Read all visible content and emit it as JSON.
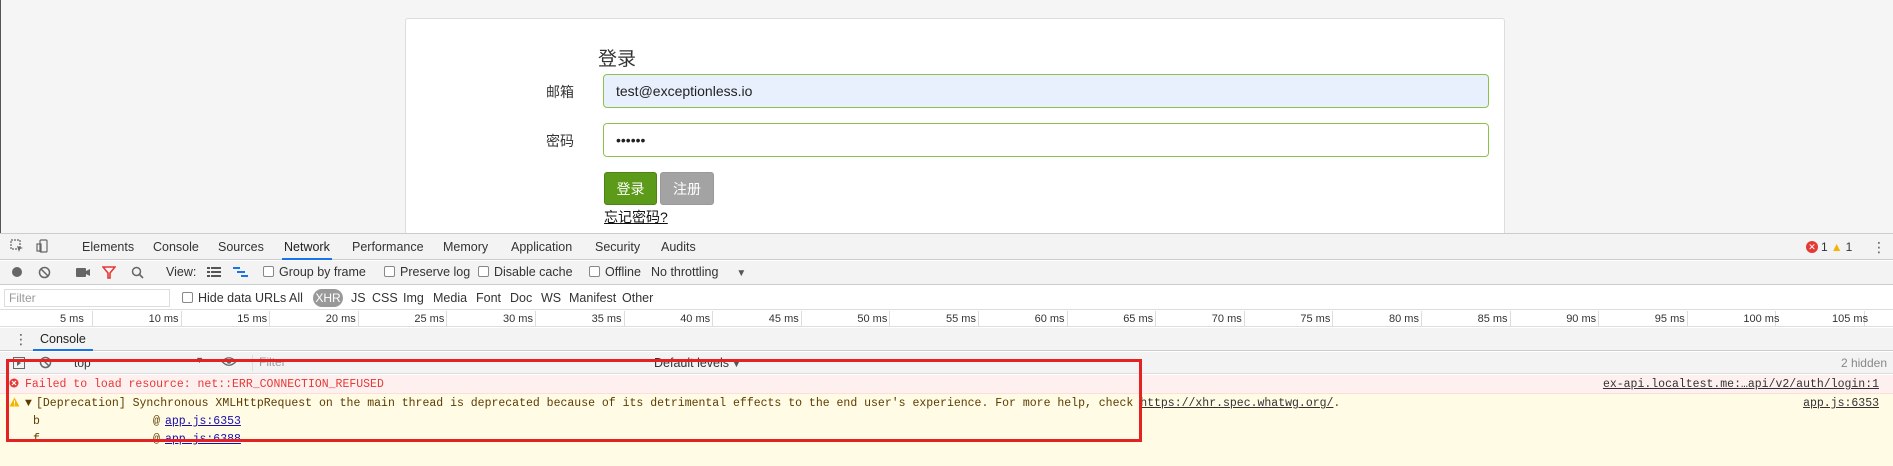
{
  "page": {
    "title": "登录",
    "email_label": "邮箱",
    "email_value": "test@exceptionless.io",
    "password_label": "密码",
    "password_value": "••••••",
    "login_button": "登录",
    "register_button": "注册",
    "forgot_link": "忘记密码?"
  },
  "devtools": {
    "tabs": [
      "Elements",
      "Console",
      "Sources",
      "Network",
      "Performance",
      "Memory",
      "Application",
      "Security",
      "Audits"
    ],
    "active_tab": "Network",
    "error_count": "1",
    "warning_count": "1",
    "toolbar": {
      "view_label": "View:",
      "group_by_frame": "Group by frame",
      "preserve_log": "Preserve log",
      "disable_cache": "Disable cache",
      "offline": "Offline",
      "throttling": "No throttling"
    },
    "filterbar": {
      "filter_placeholder": "Filter",
      "hide_data_urls": "Hide data URLs",
      "types": [
        "All",
        "XHR",
        "JS",
        "CSS",
        "Img",
        "Media",
        "Font",
        "Doc",
        "WS",
        "Manifest",
        "Other"
      ],
      "active_type": "XHR"
    },
    "timeline_ticks": [
      "5 ms",
      "10 ms",
      "15 ms",
      "20 ms",
      "25 ms",
      "30 ms",
      "35 ms",
      "40 ms",
      "45 ms",
      "50 ms",
      "55 ms",
      "60 ms",
      "65 ms",
      "70 ms",
      "75 ms",
      "80 ms",
      "85 ms",
      "90 ms",
      "95 ms",
      "100 ms",
      "105 ms"
    ],
    "drawer_tab": "Console",
    "console": {
      "context": "top",
      "filter_placeholder": "Filter",
      "levels": "Default levels",
      "hidden": "2 hidden",
      "messages": {
        "error_text": "Failed to load resource: net::ERR_CONNECTION_REFUSED",
        "error_source": "ex-api.localtest.me:…api/v2/auth/login:1",
        "warn_text": "[Deprecation] Synchronous XMLHttpRequest on the main thread is deprecated because of its detrimental effects to the end user's experience. For more help, check",
        "warn_link": "https://xhr.spec.whatwg.org/",
        "warn_period": ".",
        "warn_source": "app.js:6353",
        "stack": [
          {
            "fn": "b",
            "at": "@",
            "src": "app.js:6353"
          },
          {
            "fn": "f",
            "at": "@",
            "src": "app.js:6388"
          }
        ]
      }
    }
  }
}
